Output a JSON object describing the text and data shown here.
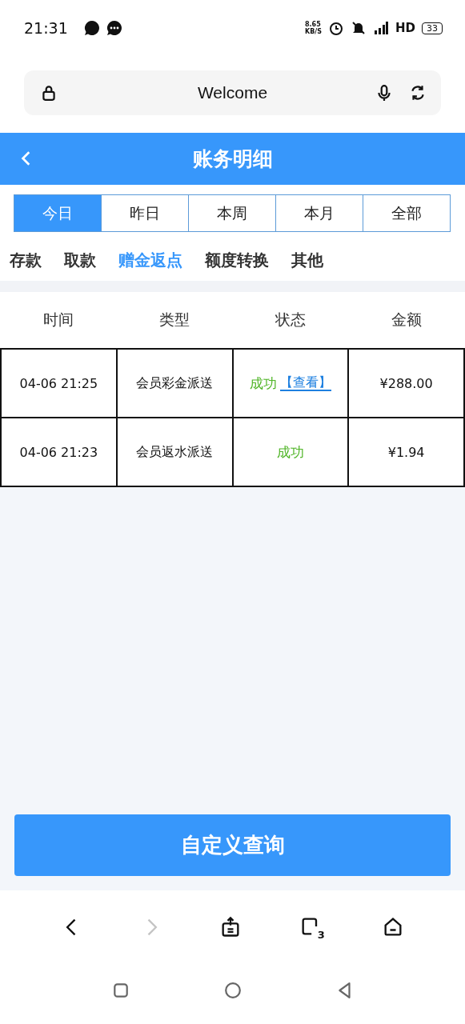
{
  "status_bar": {
    "time": "21:31",
    "net_speed": "8.65",
    "net_unit": "KB/S",
    "network": "HD",
    "battery": "33"
  },
  "address_bar": {
    "title": "Welcome"
  },
  "header": {
    "title": "账务明细"
  },
  "period_tabs": [
    {
      "label": "今日",
      "selected": true
    },
    {
      "label": "昨日",
      "selected": false
    },
    {
      "label": "本周",
      "selected": false
    },
    {
      "label": "本月",
      "selected": false
    },
    {
      "label": "全部",
      "selected": false
    }
  ],
  "category_tabs": [
    {
      "label": "存款",
      "selected": false
    },
    {
      "label": "取款",
      "selected": false
    },
    {
      "label": "赠金返点",
      "selected": true
    },
    {
      "label": "额度转换",
      "selected": false
    },
    {
      "label": "其他",
      "selected": false
    }
  ],
  "table": {
    "columns": [
      "时间",
      "类型",
      "状态",
      "金额"
    ],
    "rows": [
      {
        "time": "04-06 21:25",
        "type": "会员彩金派送",
        "status": "成功",
        "link": "【查看】",
        "amount": "¥288.00"
      },
      {
        "time": "04-06 21:23",
        "type": "会员返水派送",
        "status": "成功",
        "amount": "¥1.94"
      }
    ]
  },
  "query_button": "自定义查询",
  "browser_toolbar": {
    "forward_disabled": true,
    "tab_count": "3"
  }
}
